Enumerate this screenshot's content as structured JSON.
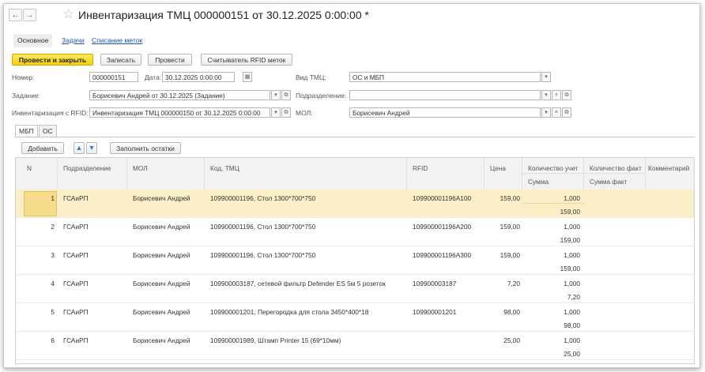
{
  "window": {
    "title": "Инвентаризация ТМЦ 000000151 от 30.12.2025 0:00:00 *",
    "back_icon": "arrow-left-icon",
    "forward_icon": "arrow-right-icon",
    "favorite_icon": "star-icon"
  },
  "section_tabs": [
    "Основное",
    "Задачи",
    "Списание меток"
  ],
  "toolbar": {
    "post_close": "Провести и закрыть",
    "save": "Записать",
    "post": "Провести",
    "rfid_reader": "Считыватель RFID меток"
  },
  "form": {
    "number_label": "Номер:",
    "number_value": "000000151",
    "date_label": "Дата:",
    "date_value": "30.12.2025  0:00:00",
    "type_label": "Вид ТМЦ:",
    "type_value": "ОС и МБП",
    "task_label": "Задание:",
    "task_value": "Борисевич Андрей от 30.12.2025 (Задание)",
    "division_label": "Подразделение:",
    "division_value": "",
    "rfid_inv_label": "Инвентаризация с RFID:",
    "rfid_inv_value": "Инвентаризация ТМЦ 000000150 от 30.12.2025 0:00:00",
    "mol_label": "МОЛ:",
    "mol_value": "Борисевич Андрей"
  },
  "page_tabs": [
    "МБП",
    "ОС"
  ],
  "table_toolbar": {
    "add": "Добавить",
    "fill": "Заполнить остатки"
  },
  "table": {
    "headers": {
      "n": "N",
      "division": "Подразделение",
      "mol": "МОЛ",
      "code": "Код, ТМЦ",
      "rfid": "RFID",
      "price": "Цена",
      "qty_acc": "Количество учет",
      "sum": "Сумма",
      "qty_fact": "Количество факт",
      "sum_fact": "Сумма факт",
      "comment": "Комментарий"
    },
    "rows": [
      {
        "n": "1",
        "division": "ГСАиРП",
        "mol": "Борисевич Андрей",
        "code": "109900001196, Стол 1300*700*750",
        "rfid": "109900001196A100",
        "price": "159,00",
        "qty": "1,000",
        "sum": "159,00"
      },
      {
        "n": "2",
        "division": "ГСАиРП",
        "mol": "Борисевич Андрей",
        "code": "109900001196, Стол 1300*700*750",
        "rfid": "109900001196A200",
        "price": "159,00",
        "qty": "1,000",
        "sum": "159,00"
      },
      {
        "n": "3",
        "division": "ГСАиРП",
        "mol": "Борисевич Андрей",
        "code": "109900001196, Стол 1300*700*750",
        "rfid": "109900001196A300",
        "price": "159,00",
        "qty": "1,000",
        "sum": "159,00"
      },
      {
        "n": "4",
        "division": "ГСАиРП",
        "mol": "Борисевич Андрей",
        "code": "109900003187, сетевой фильтр Defender ES 5м 5 розеток",
        "rfid": "109900003187",
        "price": "7,20",
        "qty": "1,000",
        "sum": "7,20"
      },
      {
        "n": "5",
        "division": "ГСАиРП",
        "mol": "Борисевич Андрей",
        "code": "109900001201, Перегородка для стола 3450*400*18",
        "rfid": "109900001201",
        "price": "98,00",
        "qty": "1,000",
        "sum": "98,00"
      },
      {
        "n": "6",
        "division": "ГСАиРП",
        "mol": "Борисевич Андрей",
        "code": "109900001989, Штамп Printer 15 (69*10мм)",
        "rfid": "",
        "price": "25,00",
        "qty": "1,000",
        "sum": "25,00"
      }
    ]
  }
}
